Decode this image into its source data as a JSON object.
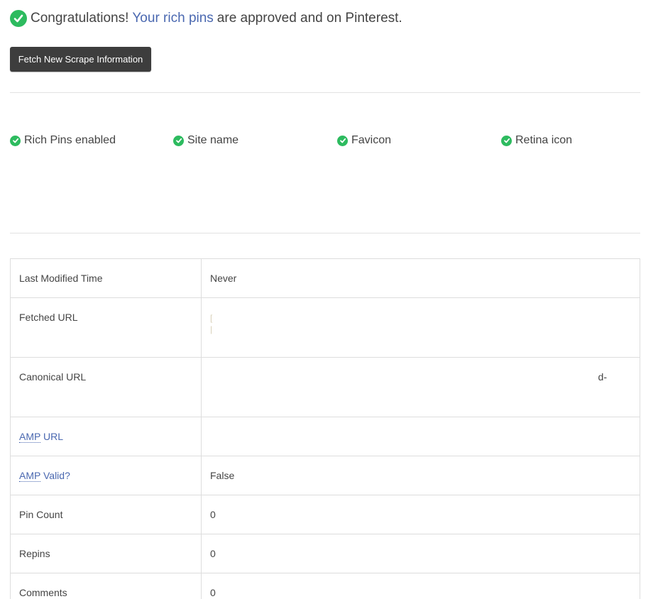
{
  "header": {
    "congrats_prefix": "Congratulations!",
    "congrats_link": "Your rich pins",
    "congrats_suffix": "are approved and on Pinterest.",
    "check_icon": "check-circle-icon",
    "success_color": "#2dbb5f",
    "link_color": "#4a68b0"
  },
  "toolbar": {
    "fetch_label": "Fetch New Scrape Information"
  },
  "features": [
    {
      "label": "Rich Pins enabled",
      "icon": "check-circle-icon"
    },
    {
      "label": "Site name",
      "icon": "check-circle-icon"
    },
    {
      "label": "Favicon",
      "icon": "check-circle-icon"
    },
    {
      "label": "Retina icon",
      "icon": "check-circle-icon"
    }
  ],
  "table": {
    "rows": [
      {
        "label": "Last Modified Time",
        "value": "Never"
      },
      {
        "label": "Fetched URL",
        "value": ""
      },
      {
        "label": "Canonical URL",
        "value": "d-"
      },
      {
        "label_abbr": "AMP",
        "label_rest": " URL",
        "value": ""
      },
      {
        "label_abbr": "AMP",
        "label_rest": " Valid?",
        "value": "False"
      },
      {
        "label": "Pin Count",
        "value": "0"
      },
      {
        "label": "Repins",
        "value": "0"
      },
      {
        "label": "Comments",
        "value": "0"
      }
    ]
  }
}
